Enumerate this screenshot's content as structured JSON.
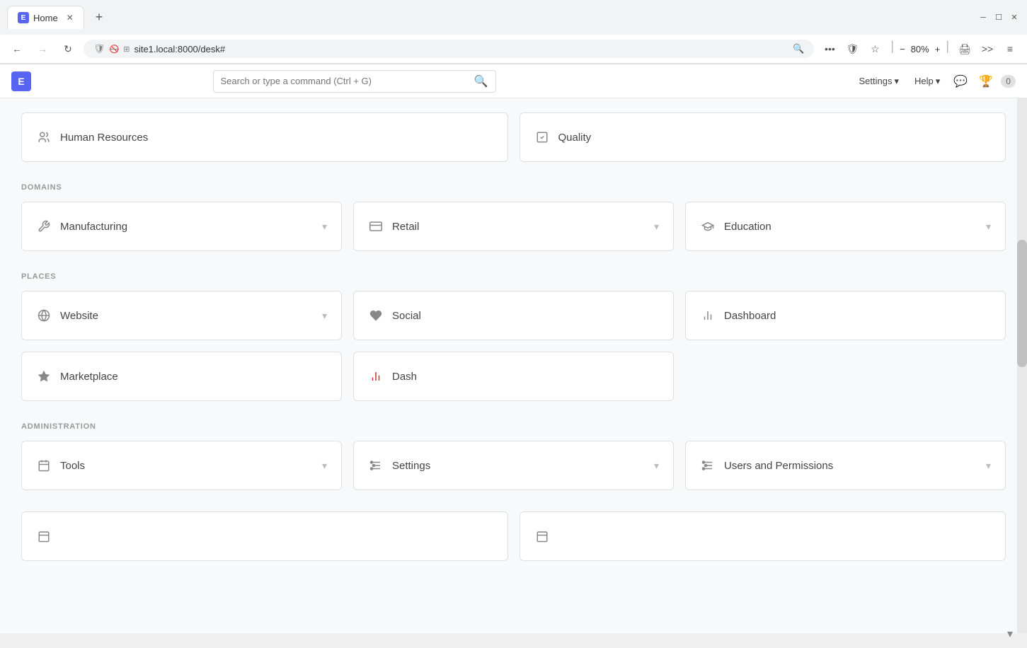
{
  "browser": {
    "tab_label": "Home",
    "tab_icon": "E",
    "close_icon": "✕",
    "new_tab_icon": "+",
    "url": "site1.local:8000/desk#",
    "zoom": "80%",
    "back_icon": "←",
    "forward_icon": "→",
    "reload_icon": "↻",
    "more_icon": "•••",
    "bookmark_icon": "☆",
    "shield_icon": "🛡",
    "zoom_minus": "−",
    "zoom_plus": "+",
    "print_icon": "🖨",
    "menu_icon": "≡"
  },
  "header": {
    "logo": "E",
    "search_placeholder": "Search or type a command (Ctrl + G)",
    "settings_label": "Settings",
    "help_label": "Help",
    "settings_arrow": "▾",
    "help_arrow": "▾",
    "notif_count": "0"
  },
  "sections": {
    "top_partial": {
      "label": "",
      "items": [
        {
          "icon": "👥",
          "label": "Human Resources",
          "has_chevron": false
        },
        {
          "icon": "◻",
          "label": "Quality",
          "has_chevron": false
        }
      ]
    },
    "domains": {
      "label": "DOMAINS",
      "items": [
        {
          "icon": "🔧",
          "label": "Manufacturing",
          "has_chevron": true
        },
        {
          "icon": "💳",
          "label": "Retail",
          "has_chevron": true
        },
        {
          "icon": "🎓",
          "label": "Education",
          "has_chevron": true
        }
      ]
    },
    "places": {
      "label": "PLACES",
      "row1": [
        {
          "icon": "🌐",
          "label": "Website",
          "has_chevron": true
        },
        {
          "icon": "♥",
          "label": "Social",
          "has_chevron": false
        },
        {
          "icon": "📊",
          "label": "Dashboard",
          "has_chevron": false
        }
      ],
      "row2": [
        {
          "icon": "⭐",
          "label": "Marketplace",
          "has_chevron": false
        },
        {
          "icon": "📊",
          "label": "Dash",
          "has_chevron": false
        }
      ]
    },
    "administration": {
      "label": "ADMINISTRATION",
      "items": [
        {
          "icon": "📅",
          "label": "Tools",
          "has_chevron": true
        },
        {
          "icon": "⚙",
          "label": "Settings",
          "has_chevron": true
        },
        {
          "icon": "⚙",
          "label": "Users and Permissions",
          "has_chevron": true
        }
      ]
    },
    "bottom_partial": {
      "items": [
        {
          "icon": "📋",
          "label": "",
          "has_chevron": false
        },
        {
          "icon": "📋",
          "label": "",
          "has_chevron": false
        }
      ]
    }
  },
  "colors": {
    "accent": "#5865f2",
    "section_label": "#999999",
    "card_border": "#e0e0e0",
    "card_icon": "#888888"
  }
}
